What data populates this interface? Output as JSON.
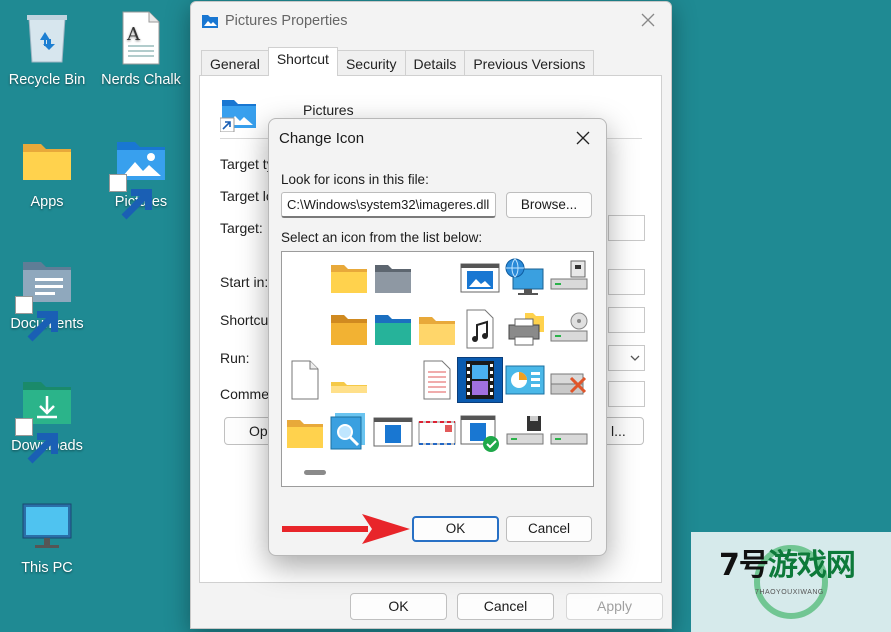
{
  "desktop": {
    "icons": [
      {
        "label": "Recycle Bin"
      },
      {
        "label": "Nerds Chalk"
      },
      {
        "label": "Apps"
      },
      {
        "label": "Pictures"
      },
      {
        "label": "Documents"
      },
      {
        "label": "Downloads"
      },
      {
        "label": "This PC"
      }
    ]
  },
  "props": {
    "title": "Pictures Properties",
    "tabs": [
      "General",
      "Shortcut",
      "Security",
      "Details",
      "Previous Versions"
    ],
    "active_tab": "Shortcut",
    "name": "Pictures",
    "labels": {
      "target_type": "Target ty",
      "target_location": "Target lo",
      "target": "Target:",
      "start_in": "Start in:",
      "shortcut_key": "Shortcut",
      "run": "Run:",
      "comment": "Commen",
      "open_btn": "Ope",
      "change_btn": "l..."
    },
    "buttons": {
      "ok": "OK",
      "cancel": "Cancel",
      "apply": "Apply"
    }
  },
  "dialog": {
    "title": "Change Icon",
    "look_label": "Look for icons in this file:",
    "path_value": "C:\\Windows\\system32\\imageres.dll",
    "browse": "Browse...",
    "select_label": "Select an icon from the list below:",
    "ok": "OK",
    "cancel": "Cancel",
    "selected_icon": "film-strip-icon"
  },
  "colors": {
    "desktop": "#1f8a93",
    "accent": "#2770c5",
    "selection": "#0a5bb0",
    "arrow": "#e8252a"
  },
  "watermark": {
    "logo_num": "7号",
    "logo_text": "游戏网",
    "sub": "7HAOYOUXIWANG"
  }
}
